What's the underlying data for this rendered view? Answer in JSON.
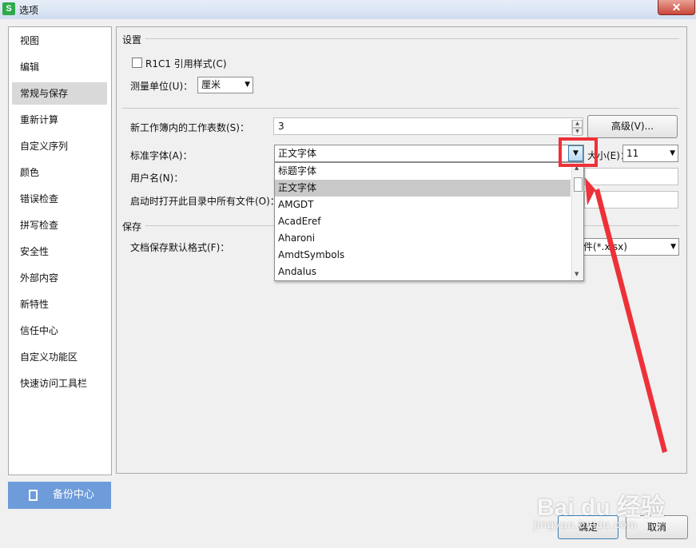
{
  "window": {
    "title": "选项",
    "app_icon": "S",
    "close_label": "✕"
  },
  "sidebar": {
    "items": [
      {
        "label": "视图"
      },
      {
        "label": "编辑"
      },
      {
        "label": "常规与保存",
        "selected": true
      },
      {
        "label": "重新计算"
      },
      {
        "label": "自定义序列"
      },
      {
        "label": "颜色"
      },
      {
        "label": "错误检查"
      },
      {
        "label": "拼写检查"
      },
      {
        "label": "安全性"
      },
      {
        "label": "外部内容"
      },
      {
        "label": "新特性"
      },
      {
        "label": "信任中心"
      },
      {
        "label": "自定义功能区"
      },
      {
        "label": "快速访问工具栏"
      }
    ],
    "backup_label": "备份中心"
  },
  "settings": {
    "group_title": "设置",
    "r1c1_label": "R1C1 引用样式(C)",
    "r1c1_checked": false,
    "unit_label": "测量单位(U)：",
    "unit_value": "厘米",
    "sheets_label": "新工作簿内的工作表数(S)：",
    "sheets_value": "3",
    "advanced_label": "高级(V)...",
    "std_font_label": "标准字体(A)：",
    "std_font_value": "正文字体",
    "size_label": "大小(E)：",
    "size_value": "11",
    "username_label": "用户名(N)：",
    "startup_label": "启动时打开此目录中所有文件(O)："
  },
  "save": {
    "group_title": "保存",
    "format_label": "文档保存默认格式(F)：",
    "format_value": "文件(*.xlsx)"
  },
  "font_dropdown": {
    "items": [
      {
        "label": "标题字体"
      },
      {
        "label": "正文字体",
        "selected": true
      },
      {
        "label": "AMGDT"
      },
      {
        "label": "AcadEref"
      },
      {
        "label": "Aharoni"
      },
      {
        "label": "AmdtSymbols"
      },
      {
        "label": "Andalus"
      }
    ]
  },
  "footer": {
    "ok_label": "确定",
    "cancel_label": "取消"
  },
  "watermark": {
    "text": "Bai du 经验",
    "url": "jingyan.baidu.com"
  },
  "colors": {
    "annotation": "#ee3138",
    "selected_bg": "#d9d9d9",
    "backup_bg": "#6e9cda"
  },
  "icons": [
    "close-icon",
    "backup-icon",
    "dropdown-arrow-icon",
    "spin-up-icon",
    "spin-down-icon"
  ]
}
